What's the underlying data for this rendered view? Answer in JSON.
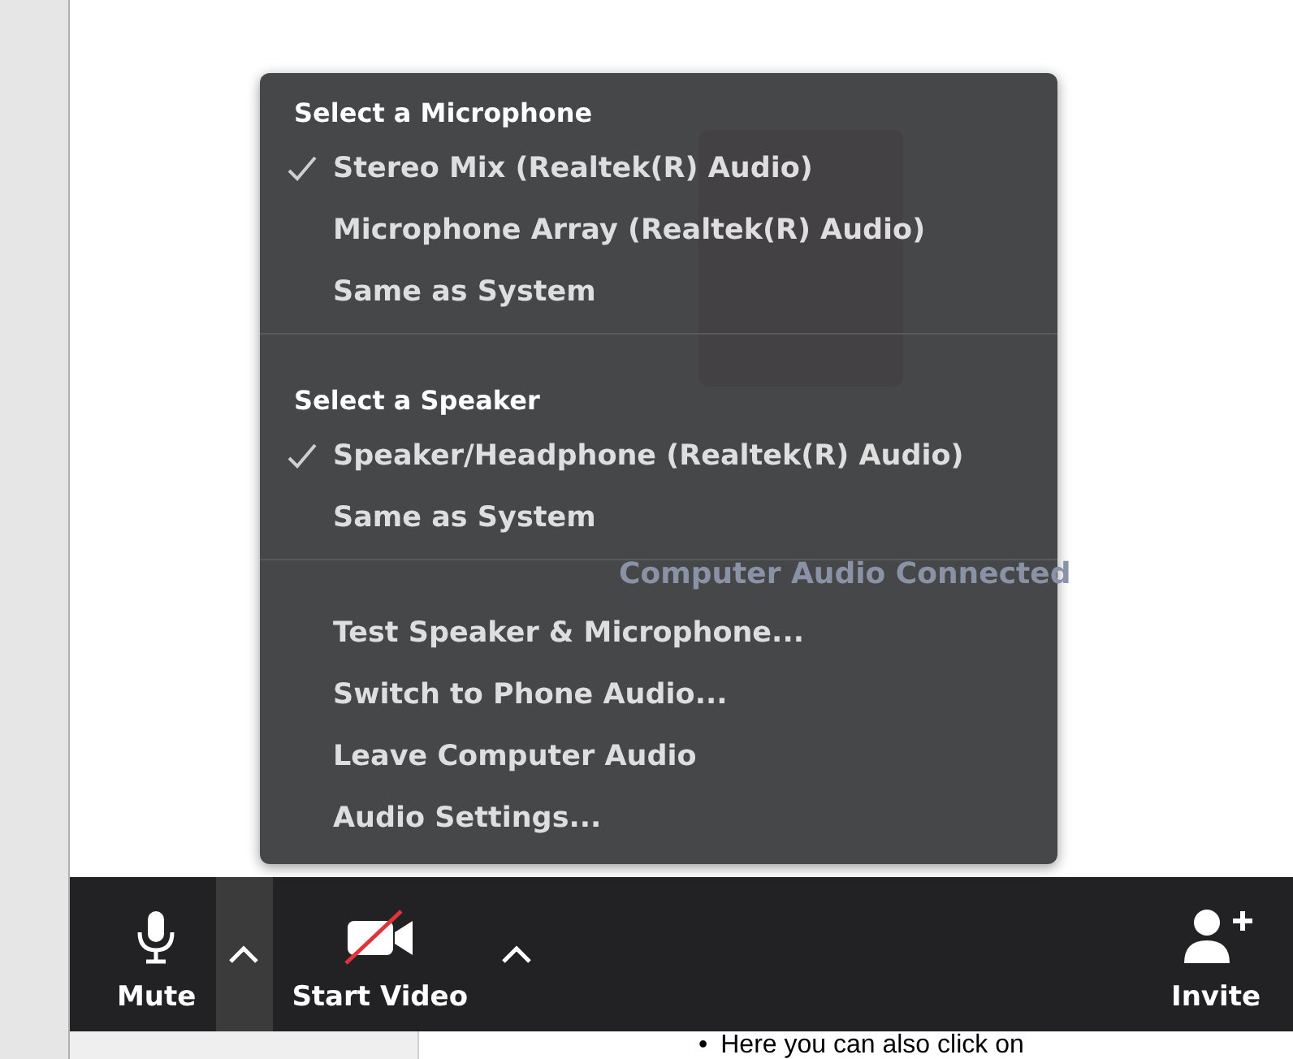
{
  "background": {
    "status": "Computer Audio Connected"
  },
  "menu": {
    "sections": [
      {
        "header": "Select a Microphone",
        "items": [
          {
            "label": "Stereo Mix (Realtek(R) Audio)",
            "checked": true
          },
          {
            "label": "Microphone Array (Realtek(R) Audio)",
            "checked": false
          },
          {
            "label": "Same as System",
            "checked": false
          }
        ]
      },
      {
        "header": "Select a Speaker",
        "items": [
          {
            "label": "Speaker/Headphone (Realtek(R) Audio)",
            "checked": true
          },
          {
            "label": "Same as System",
            "checked": false
          }
        ]
      },
      {
        "items": [
          {
            "label": "Test Speaker & Microphone...",
            "checked": false
          },
          {
            "label": "Switch to Phone Audio...",
            "checked": false
          },
          {
            "label": "Leave Computer Audio",
            "checked": false
          },
          {
            "label": "Audio Settings...",
            "checked": false
          }
        ]
      }
    ]
  },
  "toolbar": {
    "buttons": [
      {
        "kind": "mic",
        "label": "Mute"
      },
      {
        "kind": "caret",
        "selected": true
      },
      {
        "kind": "video",
        "label": "Start Video"
      },
      {
        "kind": "caret",
        "selected": false
      },
      {
        "kind": "spacer"
      },
      {
        "kind": "invite",
        "label": "Invite"
      }
    ]
  },
  "document": {
    "bullet": "•",
    "text": "Here you can also click on"
  }
}
